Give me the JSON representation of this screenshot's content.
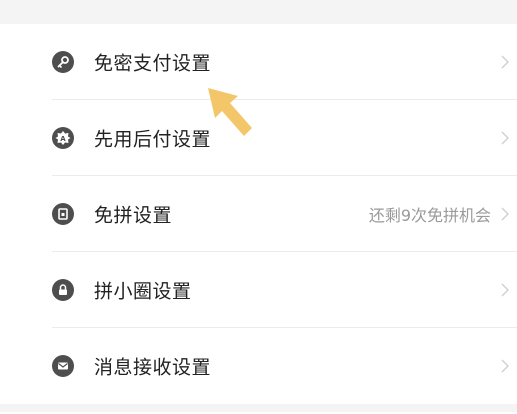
{
  "settings": {
    "items": [
      {
        "label": "免密支付设置",
        "aux": "",
        "icon": "key-icon"
      },
      {
        "label": "先用后付设置",
        "aux": "",
        "icon": "gear-badge-icon"
      },
      {
        "label": "免拼设置",
        "aux": "还剩9次免拼机会",
        "icon": "document-icon"
      },
      {
        "label": "拼小圈设置",
        "aux": "",
        "icon": "lock-icon"
      },
      {
        "label": "消息接收设置",
        "aux": "",
        "icon": "mail-icon"
      }
    ]
  },
  "colors": {
    "icon_bg": "#4e4e4e",
    "pointer_arrow": "#f3c66a",
    "page_bg": "#f4f4f4"
  }
}
